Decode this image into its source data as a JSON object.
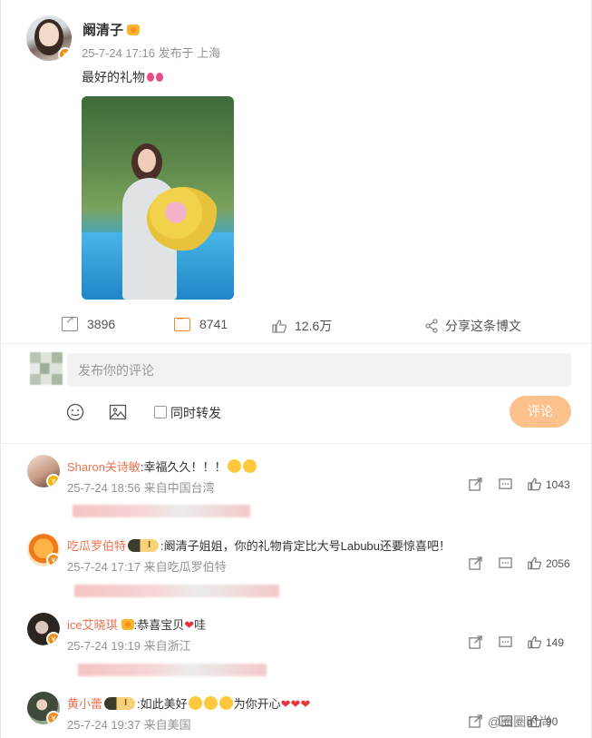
{
  "post": {
    "username": "阚清子",
    "meta": "25-7-24 17:16  发布于 上海",
    "text": "最好的礼物",
    "actions": {
      "reposts": "3896",
      "comments": "8741",
      "likes": "12.6万",
      "share_label": "分享这条博文"
    }
  },
  "composer": {
    "placeholder": "发布你的评论",
    "repost_checkbox_label": "同时转发",
    "submit_label": "评论"
  },
  "comments": [
    {
      "name": "Sharon关诗敏",
      "text": ":幸福久久！！！",
      "meta": "25-7-24 18:56  来自中国台湾",
      "likes": "1043"
    },
    {
      "name": "吃瓜罗伯特",
      "text": ":阚清子姐姐，你的礼物肯定比大号Labubu还要惊喜吧！",
      "meta": "25-7-24 17:17  来自吃瓜罗伯特",
      "likes": "2056"
    },
    {
      "name": "ice艾晓琪",
      "text": ":恭喜宝贝",
      "text_tail": "哇",
      "meta": "25-7-24 19:19  来自浙江",
      "likes": "149"
    },
    {
      "name": "黄小蕾",
      "text": ":如此美好",
      "text_tail": "为你开心",
      "meta": "25-7-24 19:37  来自美国",
      "likes": "90"
    }
  ],
  "watermark": "@圈圈时尚",
  "colors": {
    "accent": "#f08c1e",
    "name": "#eb7350",
    "button": "#fdc28c"
  }
}
